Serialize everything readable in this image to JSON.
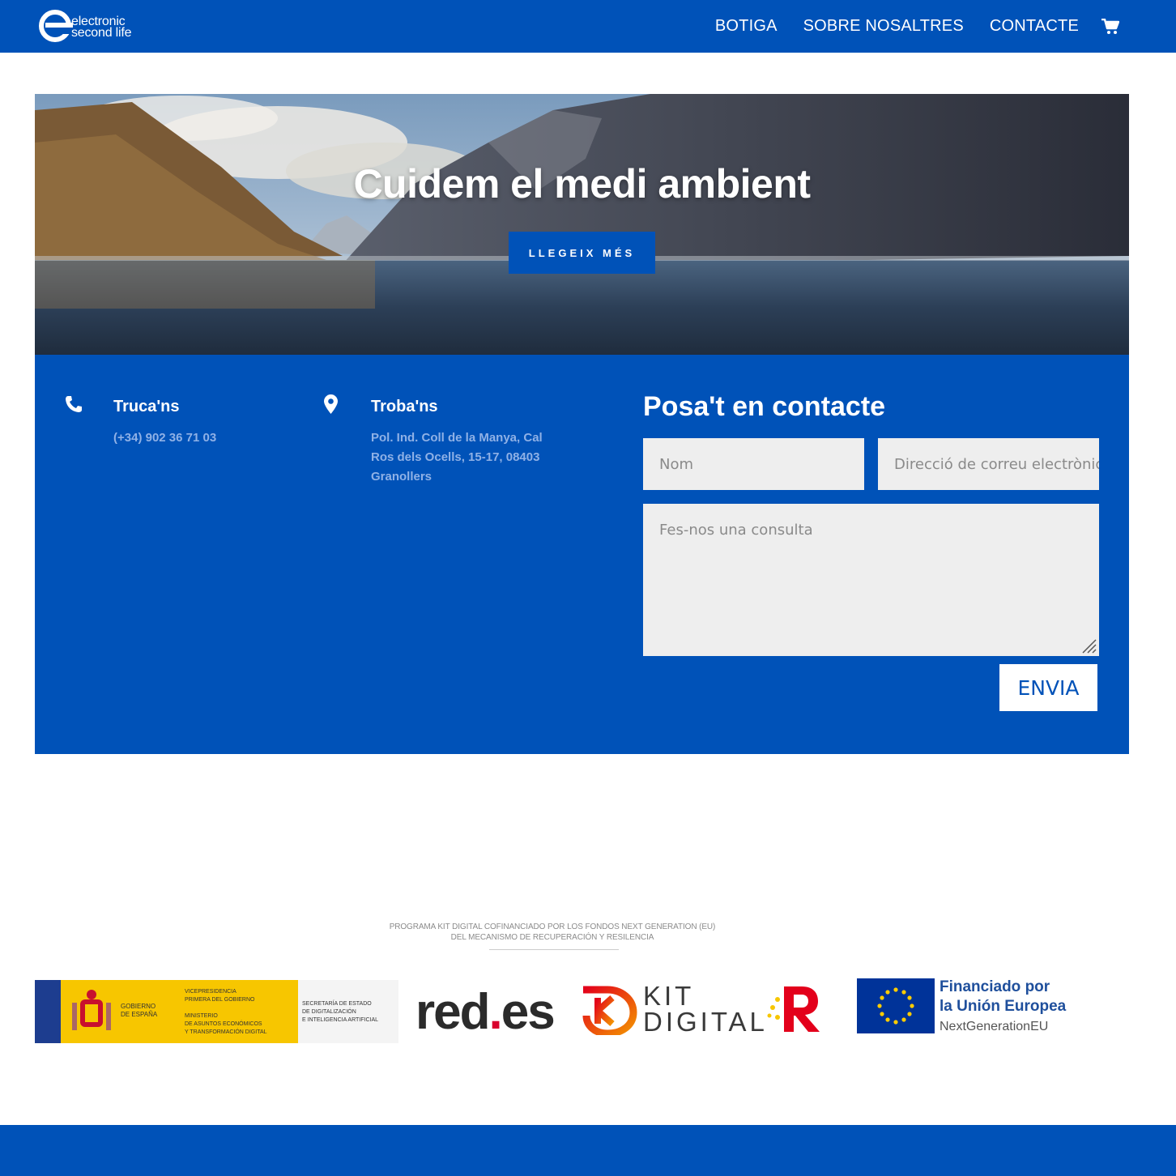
{
  "brand": {
    "logo_line1": "electronic",
    "logo_line2": "second life",
    "primary_color": "#0052b8"
  },
  "nav": {
    "items": [
      "BOTIGA",
      "SOBRE NOSALTRES",
      "CONTACTE"
    ],
    "cart_icon": "shopping-cart-icon"
  },
  "hero": {
    "title": "Cuidem el medi ambient",
    "button_label": "LLEGEIX MÉS"
  },
  "contact": {
    "phone_title": "Truca'ns",
    "phone_value": "(+34) 902 36 71 03",
    "address_title": "Troba'ns",
    "address_lines": [
      "Pol. Ind. Coll de la Manya, Cal",
      "Ros dels Ocells, 15-17, 08403",
      "Granollers"
    ],
    "form_title": "Posa't en contacte",
    "name_placeholder": "Nom",
    "email_placeholder": "Direcció de correu electrònic",
    "message_placeholder": "Fes-nos una consulta",
    "send_label": "ENVIA"
  },
  "funding": {
    "line1": "PROGRAMA KIT DIGITAL COFINANCIADO POR LOS FONDOS NEXT GENERATION (EU)",
    "line2": "DEL MECANISMO DE RECUPERACIÓN Y RESILENCIA",
    "gov_left": [
      "GOBIERNO",
      "DE ESPAÑA"
    ],
    "gov_mid": [
      "VICEPRESIDENCIA",
      "PRIMERA DEL GOBIERNO",
      "MINISTERIO",
      "DE ASUNTOS ECONÓMICOS",
      "Y TRANSFORMACIÓN DIGITAL"
    ],
    "gov_right": [
      "SECRETARÍA DE ESTADO",
      "DE DIGITALIZACIÓN",
      "E INTELIGENCIA ARTIFICIAL"
    ],
    "rede_a": "red",
    "rede_b": ".",
    "rede_c": "es",
    "kit_line1": "KIT",
    "kit_line2": "DIGITAL",
    "eu_line1": "Financiado por",
    "eu_line2": "la Unión Europea",
    "eu_line3": "NextGenerationEU"
  }
}
